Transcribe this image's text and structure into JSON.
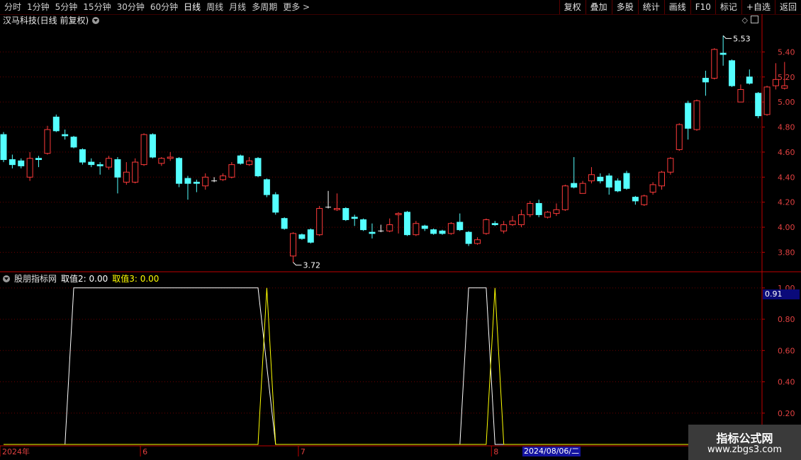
{
  "toolbar": {
    "periods": [
      "分时",
      "1分钟",
      "5分钟",
      "15分钟",
      "30分钟",
      "60分钟",
      "日线",
      "周线",
      "月线",
      "多周期",
      "更多 >"
    ],
    "active_period": "日线",
    "buttons": [
      "复权",
      "叠加",
      "多股",
      "统计",
      "画线",
      "F10",
      "标记",
      "+自选",
      "返回"
    ]
  },
  "chart": {
    "title": "汉马科技(日线 前复权)",
    "high_label": "5.53",
    "low_label": "3.72",
    "price_axis": [
      "5.40",
      "5.20",
      "5.00",
      "4.80",
      "4.60",
      "4.40",
      "4.20",
      "4.00",
      "3.80"
    ]
  },
  "indicator": {
    "name": "股朋指标网",
    "v2_label": "取值2: 0.00",
    "v3_label": "取值3: 0.00",
    "axis": [
      "1.00",
      "0.80",
      "0.60",
      "0.40",
      "0.20"
    ],
    "current_value": "0.91"
  },
  "time_axis": {
    "labels": [
      "2024年",
      "6",
      "7",
      "8"
    ],
    "cursor_date": "2024/08/06/二"
  },
  "watermark": {
    "title": "指标公式网",
    "url": "www.zbgs3.com"
  },
  "colors": {
    "up": "#ff3a3a",
    "down": "#54ffff",
    "frame": "#c00000",
    "line_white": "#ffffff",
    "line_yellow": "#ffff00"
  },
  "chart_data": {
    "type": "candlestick",
    "candles": [
      [
        4.74,
        4.54,
        4.76,
        4.52
      ],
      [
        4.54,
        4.5,
        4.58,
        4.47
      ],
      [
        4.53,
        4.49,
        4.55,
        4.47
      ],
      [
        4.4,
        4.55,
        4.6,
        4.37
      ],
      [
        4.55,
        4.54,
        4.57,
        4.48
      ],
      [
        4.59,
        4.78,
        4.81,
        4.58
      ],
      [
        4.88,
        4.77,
        4.9,
        4.76
      ],
      [
        4.74,
        4.73,
        4.78,
        4.7
      ],
      [
        4.72,
        4.64,
        4.73,
        4.63
      ],
      [
        4.62,
        4.52,
        4.63,
        4.5
      ],
      [
        4.52,
        4.5,
        4.55,
        4.48
      ],
      [
        4.5,
        4.49,
        4.52,
        4.42
      ],
      [
        4.48,
        4.55,
        4.57,
        4.46
      ],
      [
        4.54,
        4.4,
        4.56,
        4.27
      ],
      [
        4.36,
        4.44,
        4.52,
        4.34
      ],
      [
        4.36,
        4.52,
        4.55,
        4.35
      ],
      [
        4.5,
        4.74,
        4.75,
        4.49
      ],
      [
        4.74,
        4.56,
        4.75,
        4.55
      ],
      [
        4.51,
        4.55,
        4.56,
        4.49
      ],
      [
        4.55,
        4.56,
        4.6,
        4.53
      ],
      [
        4.55,
        4.35,
        4.56,
        4.32
      ],
      [
        4.39,
        4.35,
        4.41,
        4.22
      ],
      [
        4.36,
        4.35,
        4.38,
        4.28
      ],
      [
        4.33,
        4.4,
        4.43,
        4.3
      ],
      [
        4.37,
        4.37,
        4.4,
        4.36
      ],
      [
        4.38,
        4.41,
        4.43,
        4.37
      ],
      [
        4.4,
        4.5,
        4.52,
        4.39
      ],
      [
        4.57,
        4.51,
        4.58,
        4.5
      ],
      [
        4.5,
        4.53,
        4.56,
        4.49
      ],
      [
        4.55,
        4.41,
        4.56,
        4.4
      ],
      [
        4.38,
        4.26,
        4.39,
        4.24
      ],
      [
        4.26,
        4.12,
        4.28,
        4.1
      ],
      [
        4.07,
        3.99,
        4.08,
        3.98
      ],
      [
        3.77,
        3.95,
        3.96,
        3.72
      ],
      [
        3.94,
        3.91,
        3.95,
        3.9
      ],
      [
        3.98,
        3.88,
        3.99,
        3.87
      ],
      [
        3.94,
        4.15,
        4.17,
        3.93
      ],
      [
        4.16,
        4.16,
        4.29,
        4.15
      ],
      [
        4.14,
        4.15,
        4.27,
        4.13
      ],
      [
        4.15,
        4.06,
        4.16,
        4.05
      ],
      [
        4.08,
        4.07,
        4.1,
        4.01
      ],
      [
        4.06,
        3.98,
        4.07,
        3.97
      ],
      [
        3.96,
        3.95,
        4.03,
        3.91
      ],
      [
        3.97,
        3.97,
        4.02,
        3.96
      ],
      [
        3.97,
        4.02,
        4.07,
        3.96
      ],
      [
        4.1,
        4.11,
        4.12,
        3.95
      ],
      [
        4.12,
        3.94,
        4.13,
        3.93
      ],
      [
        3.94,
        4.03,
        4.05,
        3.93
      ],
      [
        4.01,
        3.99,
        4.02,
        3.97
      ],
      [
        3.98,
        3.95,
        3.99,
        3.94
      ],
      [
        3.97,
        3.95,
        3.98,
        3.94
      ],
      [
        3.95,
        4.03,
        4.04,
        3.94
      ],
      [
        4.04,
        3.98,
        4.11,
        3.97
      ],
      [
        3.96,
        3.87,
        3.97,
        3.85
      ],
      [
        3.87,
        3.9,
        3.92,
        3.86
      ],
      [
        3.95,
        4.06,
        4.07,
        3.94
      ],
      [
        4.03,
        4.02,
        4.05,
        4.01
      ],
      [
        3.97,
        4.02,
        4.05,
        3.95
      ],
      [
        4.02,
        4.05,
        4.09,
        4.01
      ],
      [
        4.02,
        4.1,
        4.14,
        4.0
      ],
      [
        4.1,
        4.19,
        4.21,
        4.08
      ],
      [
        4.19,
        4.1,
        4.22,
        4.08
      ],
      [
        4.08,
        4.12,
        4.13,
        4.07
      ],
      [
        4.11,
        4.14,
        4.19,
        4.09
      ],
      [
        4.14,
        4.33,
        4.34,
        4.13
      ],
      [
        4.35,
        4.32,
        4.56,
        4.31
      ],
      [
        4.27,
        4.35,
        4.37,
        4.27
      ],
      [
        4.37,
        4.42,
        4.48,
        4.35
      ],
      [
        4.4,
        4.37,
        4.43,
        4.35
      ],
      [
        4.41,
        4.32,
        4.43,
        4.26
      ],
      [
        4.37,
        4.29,
        4.39,
        4.28
      ],
      [
        4.43,
        4.31,
        4.45,
        4.3
      ],
      [
        4.24,
        4.21,
        4.25,
        4.18
      ],
      [
        4.18,
        4.25,
        4.26,
        4.17
      ],
      [
        4.28,
        4.34,
        4.36,
        4.26
      ],
      [
        4.33,
        4.44,
        4.45,
        4.3
      ],
      [
        4.44,
        4.55,
        4.56,
        4.42
      ],
      [
        4.62,
        4.82,
        4.83,
        4.61
      ],
      [
        4.99,
        4.79,
        5.01,
        4.7
      ],
      [
        4.78,
        5.01,
        5.02,
        4.77
      ],
      [
        5.19,
        5.16,
        5.25,
        5.05
      ],
      [
        5.19,
        5.42,
        5.43,
        5.18
      ],
      [
        5.39,
        5.38,
        5.53,
        5.29
      ],
      [
        5.33,
        5.13,
        5.34,
        5.12
      ],
      [
        5.0,
        5.1,
        5.14,
        5.0
      ],
      [
        5.2,
        5.15,
        5.26,
        5.14
      ],
      [
        5.07,
        4.89,
        5.08,
        4.87
      ],
      [
        4.9,
        5.12,
        5.13,
        4.89
      ],
      [
        5.13,
        5.18,
        5.31,
        5.1
      ],
      [
        5.11,
        5.13,
        5.32,
        5.1
      ]
    ],
    "indicator_series": [
      {
        "name": "取值2",
        "points": [
          [
            7,
            0
          ],
          [
            8,
            1
          ],
          [
            29,
            1
          ],
          [
            30,
            0.5
          ],
          [
            31,
            0
          ],
          [
            52,
            0
          ],
          [
            53,
            1
          ],
          [
            55,
            1
          ],
          [
            56,
            0
          ]
        ]
      },
      {
        "name": "取值3",
        "points": [
          [
            29,
            0
          ],
          [
            30,
            1
          ],
          [
            31,
            0
          ],
          [
            55,
            0
          ],
          [
            56,
            1
          ],
          [
            57,
            0
          ]
        ]
      }
    ],
    "price_range": [
      3.65,
      5.6
    ],
    "indicator_range": [
      0,
      1.04
    ]
  }
}
